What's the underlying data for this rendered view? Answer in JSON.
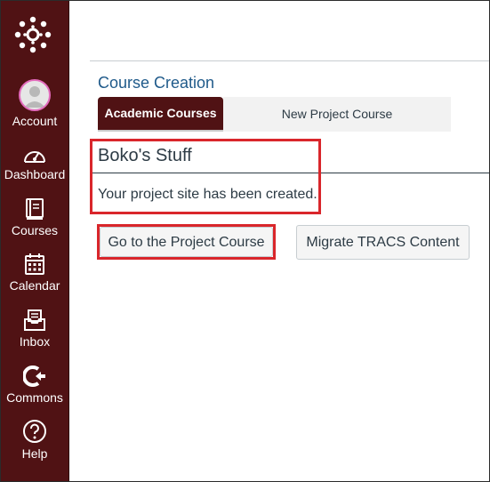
{
  "sidebar": {
    "items": [
      {
        "label": "Account",
        "icon": "avatar-icon"
      },
      {
        "label": "Dashboard",
        "icon": "dashboard-gauge-icon"
      },
      {
        "label": "Courses",
        "icon": "book-icon"
      },
      {
        "label": "Calendar",
        "icon": "calendar-icon"
      },
      {
        "label": "Inbox",
        "icon": "inbox-icon"
      },
      {
        "label": "Commons",
        "icon": "commons-icon"
      },
      {
        "label": "Help",
        "icon": "help-icon"
      }
    ]
  },
  "main": {
    "title": "Course Creation",
    "tabs": [
      {
        "label": "Academic Courses",
        "active": true
      },
      {
        "label": "New Project Course",
        "active": false
      }
    ],
    "project_name": "Boko's Stuff",
    "confirmation": "Your project site has been created.",
    "buttons": {
      "go_to_project": "Go to the Project Course",
      "migrate": "Migrate TRACS Content"
    }
  },
  "colors": {
    "sidebar_bg": "#501214",
    "highlight": "#d9262b",
    "title_blue": "#1f5a8a",
    "text": "#2d3b45"
  }
}
